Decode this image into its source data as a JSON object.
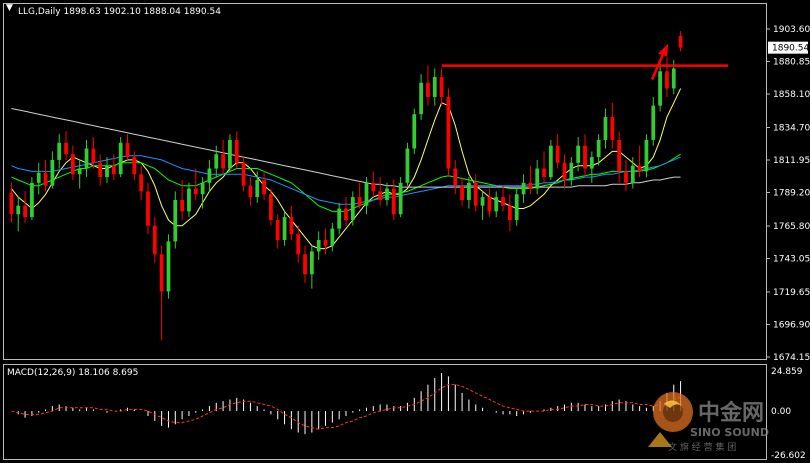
{
  "header": {
    "symbol_line": "LLG,Daily  1898.63 1902.10 1888.04 1890.54",
    "macd_line": "MACD(12,26,9) 18.106 8.695"
  },
  "price_axis": {
    "ticks": [
      "1903.60",
      "1880.85",
      "1858.10",
      "1834.70",
      "1811.95",
      "1789.20",
      "1765.80",
      "1743.05",
      "1719.65",
      "1696.90",
      "1674.15"
    ],
    "current_price": "1890.54"
  },
  "macd_axis": {
    "ticks": [
      "24.859",
      "0.00",
      "-26.602"
    ]
  },
  "watermark": {
    "chinese": "中金网",
    "english": "SINO SOUND",
    "sub": "文 旗 经 营 集 团"
  },
  "colors": {
    "background": "#000000",
    "bull_candle": "#32cd32",
    "bear_candle": "#ff0000",
    "ma_fast": "#ffff66",
    "ma_mid": "#00ff00",
    "ma_slow": "#1e90ff",
    "ma_long": "#d0d0d0",
    "annotation": "#ff0000",
    "macd_hist": "#ffffff",
    "macd_signal": "#ff3030"
  },
  "chart_data": {
    "type": "candlestick",
    "ylim": [
      1674.15,
      1903.6
    ],
    "candles": [
      {
        "o": 1789,
        "h": 1796,
        "l": 1768,
        "c": 1774
      },
      {
        "o": 1774,
        "h": 1786,
        "l": 1762,
        "c": 1780
      },
      {
        "o": 1780,
        "h": 1790,
        "l": 1768,
        "c": 1772
      },
      {
        "o": 1772,
        "h": 1800,
        "l": 1770,
        "c": 1796
      },
      {
        "o": 1796,
        "h": 1810,
        "l": 1788,
        "c": 1803
      },
      {
        "o": 1803,
        "h": 1812,
        "l": 1790,
        "c": 1794
      },
      {
        "o": 1794,
        "h": 1818,
        "l": 1792,
        "c": 1812
      },
      {
        "o": 1812,
        "h": 1830,
        "l": 1806,
        "c": 1824
      },
      {
        "o": 1824,
        "h": 1832,
        "l": 1812,
        "c": 1816
      },
      {
        "o": 1816,
        "h": 1822,
        "l": 1798,
        "c": 1802
      },
      {
        "o": 1802,
        "h": 1812,
        "l": 1792,
        "c": 1806
      },
      {
        "o": 1806,
        "h": 1826,
        "l": 1800,
        "c": 1820
      },
      {
        "o": 1820,
        "h": 1828,
        "l": 1806,
        "c": 1810
      },
      {
        "o": 1810,
        "h": 1816,
        "l": 1794,
        "c": 1800
      },
      {
        "o": 1800,
        "h": 1814,
        "l": 1796,
        "c": 1808
      },
      {
        "o": 1808,
        "h": 1816,
        "l": 1798,
        "c": 1802
      },
      {
        "o": 1802,
        "h": 1828,
        "l": 1800,
        "c": 1824
      },
      {
        "o": 1824,
        "h": 1830,
        "l": 1812,
        "c": 1814
      },
      {
        "o": 1814,
        "h": 1818,
        "l": 1798,
        "c": 1802
      },
      {
        "o": 1802,
        "h": 1808,
        "l": 1784,
        "c": 1790
      },
      {
        "o": 1790,
        "h": 1796,
        "l": 1760,
        "c": 1766
      },
      {
        "o": 1766,
        "h": 1772,
        "l": 1740,
        "c": 1746
      },
      {
        "o": 1746,
        "h": 1752,
        "l": 1686,
        "c": 1720
      },
      {
        "o": 1720,
        "h": 1760,
        "l": 1715,
        "c": 1755
      },
      {
        "o": 1755,
        "h": 1790,
        "l": 1750,
        "c": 1784
      },
      {
        "o": 1784,
        "h": 1798,
        "l": 1770,
        "c": 1776
      },
      {
        "o": 1776,
        "h": 1796,
        "l": 1772,
        "c": 1792
      },
      {
        "o": 1792,
        "h": 1806,
        "l": 1784,
        "c": 1788
      },
      {
        "o": 1788,
        "h": 1800,
        "l": 1778,
        "c": 1796
      },
      {
        "o": 1796,
        "h": 1812,
        "l": 1790,
        "c": 1806
      },
      {
        "o": 1806,
        "h": 1822,
        "l": 1800,
        "c": 1816
      },
      {
        "o": 1816,
        "h": 1826,
        "l": 1802,
        "c": 1806
      },
      {
        "o": 1806,
        "h": 1830,
        "l": 1804,
        "c": 1826
      },
      {
        "o": 1826,
        "h": 1832,
        "l": 1806,
        "c": 1810
      },
      {
        "o": 1810,
        "h": 1814,
        "l": 1790,
        "c": 1794
      },
      {
        "o": 1794,
        "h": 1800,
        "l": 1780,
        "c": 1786
      },
      {
        "o": 1786,
        "h": 1804,
        "l": 1782,
        "c": 1798
      },
      {
        "o": 1798,
        "h": 1804,
        "l": 1784,
        "c": 1788
      },
      {
        "o": 1788,
        "h": 1792,
        "l": 1766,
        "c": 1770
      },
      {
        "o": 1770,
        "h": 1774,
        "l": 1750,
        "c": 1756
      },
      {
        "o": 1756,
        "h": 1776,
        "l": 1752,
        "c": 1772
      },
      {
        "o": 1772,
        "h": 1780,
        "l": 1756,
        "c": 1760
      },
      {
        "o": 1760,
        "h": 1766,
        "l": 1740,
        "c": 1746
      },
      {
        "o": 1746,
        "h": 1752,
        "l": 1726,
        "c": 1732
      },
      {
        "o": 1732,
        "h": 1752,
        "l": 1722,
        "c": 1748
      },
      {
        "o": 1748,
        "h": 1762,
        "l": 1742,
        "c": 1756
      },
      {
        "o": 1756,
        "h": 1764,
        "l": 1746,
        "c": 1752
      },
      {
        "o": 1752,
        "h": 1768,
        "l": 1748,
        "c": 1764
      },
      {
        "o": 1764,
        "h": 1782,
        "l": 1760,
        "c": 1778
      },
      {
        "o": 1778,
        "h": 1786,
        "l": 1766,
        "c": 1770
      },
      {
        "o": 1770,
        "h": 1790,
        "l": 1766,
        "c": 1786
      },
      {
        "o": 1786,
        "h": 1796,
        "l": 1778,
        "c": 1780
      },
      {
        "o": 1780,
        "h": 1800,
        "l": 1774,
        "c": 1796
      },
      {
        "o": 1796,
        "h": 1804,
        "l": 1786,
        "c": 1790
      },
      {
        "o": 1790,
        "h": 1800,
        "l": 1780,
        "c": 1784
      },
      {
        "o": 1784,
        "h": 1796,
        "l": 1780,
        "c": 1792
      },
      {
        "o": 1792,
        "h": 1798,
        "l": 1770,
        "c": 1774
      },
      {
        "o": 1774,
        "h": 1800,
        "l": 1772,
        "c": 1796
      },
      {
        "o": 1796,
        "h": 1824,
        "l": 1794,
        "c": 1820
      },
      {
        "o": 1820,
        "h": 1848,
        "l": 1816,
        "c": 1844
      },
      {
        "o": 1844,
        "h": 1872,
        "l": 1840,
        "c": 1866
      },
      {
        "o": 1866,
        "h": 1878,
        "l": 1850,
        "c": 1856
      },
      {
        "o": 1856,
        "h": 1876,
        "l": 1850,
        "c": 1870
      },
      {
        "o": 1870,
        "h": 1876,
        "l": 1850,
        "c": 1856
      },
      {
        "o": 1856,
        "h": 1862,
        "l": 1800,
        "c": 1806
      },
      {
        "o": 1806,
        "h": 1812,
        "l": 1788,
        "c": 1794
      },
      {
        "o": 1794,
        "h": 1800,
        "l": 1780,
        "c": 1784
      },
      {
        "o": 1784,
        "h": 1800,
        "l": 1778,
        "c": 1796
      },
      {
        "o": 1796,
        "h": 1802,
        "l": 1776,
        "c": 1780
      },
      {
        "o": 1780,
        "h": 1790,
        "l": 1770,
        "c": 1786
      },
      {
        "o": 1786,
        "h": 1792,
        "l": 1772,
        "c": 1776
      },
      {
        "o": 1776,
        "h": 1790,
        "l": 1772,
        "c": 1786
      },
      {
        "o": 1786,
        "h": 1794,
        "l": 1776,
        "c": 1780
      },
      {
        "o": 1780,
        "h": 1788,
        "l": 1762,
        "c": 1770
      },
      {
        "o": 1770,
        "h": 1792,
        "l": 1766,
        "c": 1788
      },
      {
        "o": 1788,
        "h": 1802,
        "l": 1782,
        "c": 1796
      },
      {
        "o": 1796,
        "h": 1808,
        "l": 1788,
        "c": 1792
      },
      {
        "o": 1792,
        "h": 1812,
        "l": 1788,
        "c": 1806
      },
      {
        "o": 1806,
        "h": 1818,
        "l": 1796,
        "c": 1800
      },
      {
        "o": 1800,
        "h": 1826,
        "l": 1798,
        "c": 1822
      },
      {
        "o": 1822,
        "h": 1830,
        "l": 1806,
        "c": 1810
      },
      {
        "o": 1810,
        "h": 1816,
        "l": 1792,
        "c": 1798
      },
      {
        "o": 1798,
        "h": 1814,
        "l": 1794,
        "c": 1810
      },
      {
        "o": 1810,
        "h": 1828,
        "l": 1804,
        "c": 1822
      },
      {
        "o": 1822,
        "h": 1830,
        "l": 1800,
        "c": 1806
      },
      {
        "o": 1806,
        "h": 1818,
        "l": 1796,
        "c": 1814
      },
      {
        "o": 1814,
        "h": 1830,
        "l": 1808,
        "c": 1826
      },
      {
        "o": 1826,
        "h": 1848,
        "l": 1820,
        "c": 1842
      },
      {
        "o": 1842,
        "h": 1852,
        "l": 1820,
        "c": 1826
      },
      {
        "o": 1826,
        "h": 1832,
        "l": 1796,
        "c": 1804
      },
      {
        "o": 1804,
        "h": 1812,
        "l": 1790,
        "c": 1796
      },
      {
        "o": 1796,
        "h": 1814,
        "l": 1792,
        "c": 1808
      },
      {
        "o": 1808,
        "h": 1822,
        "l": 1800,
        "c": 1804
      },
      {
        "o": 1804,
        "h": 1830,
        "l": 1800,
        "c": 1826
      },
      {
        "o": 1826,
        "h": 1856,
        "l": 1822,
        "c": 1850
      },
      {
        "o": 1850,
        "h": 1880,
        "l": 1846,
        "c": 1874
      },
      {
        "o": 1874,
        "h": 1884,
        "l": 1856,
        "c": 1862
      },
      {
        "o": 1862,
        "h": 1882,
        "l": 1858,
        "c": 1876
      },
      {
        "o": 1898.63,
        "h": 1902.1,
        "l": 1888.04,
        "c": 1890.54
      }
    ],
    "moving_averages": [
      {
        "name": "",
        "color": "#ffff66",
        "values": [
          1792,
          1786,
          1782,
          1778,
          1782,
          1788,
          1796,
          1804,
          1810,
          1814,
          1812,
          1810,
          1808,
          1806,
          1806,
          1808,
          1810,
          1812,
          1812,
          1810,
          1804,
          1794,
          1780,
          1770,
          1766,
          1766,
          1770,
          1774,
          1782,
          1790,
          1796,
          1800,
          1806,
          1810,
          1810,
          1806,
          1800,
          1794,
          1790,
          1784,
          1776,
          1770,
          1764,
          1758,
          1752,
          1750,
          1750,
          1752,
          1758,
          1764,
          1770,
          1776,
          1782,
          1786,
          1788,
          1790,
          1788,
          1788,
          1792,
          1800,
          1812,
          1826,
          1840,
          1852,
          1850,
          1836,
          1818,
          1802,
          1794,
          1790,
          1786,
          1784,
          1782,
          1780,
          1778,
          1778,
          1780,
          1784,
          1788,
          1794,
          1798,
          1802,
          1806,
          1808,
          1808,
          1808,
          1810,
          1814,
          1818,
          1818,
          1814,
          1810,
          1806,
          1808,
          1814,
          1826,
          1842,
          1852,
          1862
        ]
      },
      {
        "name": "",
        "color": "#00ff00",
        "values": [
          1800,
          1798,
          1796,
          1794,
          1794,
          1796,
          1798,
          1800,
          1802,
          1804,
          1806,
          1806,
          1808,
          1808,
          1808,
          1808,
          1810,
          1810,
          1810,
          1810,
          1808,
          1806,
          1802,
          1798,
          1796,
          1794,
          1794,
          1794,
          1796,
          1798,
          1800,
          1802,
          1804,
          1806,
          1806,
          1806,
          1806,
          1804,
          1802,
          1800,
          1798,
          1796,
          1792,
          1788,
          1784,
          1780,
          1778,
          1776,
          1776,
          1776,
          1778,
          1780,
          1782,
          1784,
          1786,
          1788,
          1788,
          1789,
          1790,
          1792,
          1794,
          1796,
          1798,
          1800,
          1801,
          1800,
          1799,
          1798,
          1797,
          1796,
          1795,
          1794,
          1793,
          1792,
          1792,
          1792,
          1792,
          1793,
          1794,
          1795,
          1796,
          1798,
          1799,
          1800,
          1801,
          1802,
          1802,
          1803,
          1804,
          1804,
          1804,
          1804,
          1804,
          1805,
          1806,
          1808,
          1810,
          1813,
          1816
        ]
      },
      {
        "name": "",
        "color": "#1e90ff",
        "values": [
          1808,
          1806,
          1805,
          1804,
          1804,
          1804,
          1804,
          1805,
          1806,
          1807,
          1808,
          1809,
          1810,
          1811,
          1812,
          1813,
          1814,
          1815,
          1815,
          1815,
          1814,
          1813,
          1812,
          1810,
          1808,
          1806,
          1805,
          1804,
          1803,
          1802,
          1802,
          1802,
          1802,
          1802,
          1802,
          1801,
          1800,
          1799,
          1798,
          1796,
          1794,
          1792,
          1790,
          1788,
          1786,
          1784,
          1783,
          1782,
          1781,
          1781,
          1781,
          1782,
          1783,
          1784,
          1785,
          1786,
          1786,
          1787,
          1788,
          1789,
          1790,
          1791,
          1792,
          1793,
          1794,
          1794,
          1794,
          1794,
          1794,
          1794,
          1794,
          1794,
          1794,
          1794,
          1794,
          1794,
          1795,
          1795,
          1796,
          1796,
          1797,
          1798,
          1798,
          1799,
          1800,
          1800,
          1801,
          1802,
          1802,
          1803,
          1804,
          1804,
          1805,
          1806,
          1807,
          1808,
          1810,
          1812,
          1814
        ]
      },
      {
        "name": "",
        "color": "#d0d0d0",
        "values": [
          1848,
          1847,
          1846,
          1845,
          1844,
          1843,
          1842,
          1841,
          1840,
          1839,
          1838,
          1837,
          1836,
          1835,
          1834,
          1833,
          1832,
          1831,
          1830,
          1829,
          1828,
          1827,
          1826,
          1825,
          1824,
          1823,
          1822,
          1821,
          1820,
          1819,
          1818,
          1817,
          1816,
          1815,
          1814,
          1813,
          1812,
          1811,
          1810,
          1809,
          1808,
          1807,
          1806,
          1805,
          1804,
          1803,
          1802,
          1801,
          1800,
          1799,
          1798,
          1797,
          1796,
          1795,
          1795,
          1794,
          1794,
          1793,
          1793,
          1793,
          1793,
          1793,
          1793,
          1793,
          1793,
          1793,
          1793,
          1793,
          1793,
          1793,
          1793,
          1793,
          1793,
          1793,
          1793,
          1793,
          1793,
          1793,
          1793,
          1793,
          1793,
          1793,
          1793,
          1794,
          1794,
          1794,
          1794,
          1794,
          1795,
          1795,
          1795,
          1796,
          1796,
          1797,
          1798,
          1798,
          1799,
          1800,
          1800
        ]
      }
    ],
    "annotations": {
      "resistance_level": 1878,
      "resistance_from_index": 63,
      "arrow_index": 95
    },
    "macd": {
      "ylim": [
        -26.602,
        24.859
      ],
      "histogram": [
        0,
        -2,
        -4,
        -3,
        -1,
        1,
        3,
        4,
        3,
        2,
        1,
        2,
        1,
        0,
        -1,
        0,
        1,
        2,
        1,
        0,
        -3,
        -6,
        -9,
        -10,
        -8,
        -5,
        -3,
        -1,
        1,
        3,
        5,
        6,
        7,
        8,
        7,
        5,
        3,
        1,
        -2,
        -5,
        -8,
        -11,
        -13,
        -14,
        -13,
        -11,
        -9,
        -7,
        -5,
        -3,
        -1,
        1,
        2,
        3,
        4,
        4,
        3,
        3,
        5,
        8,
        12,
        16,
        20,
        23,
        21,
        16,
        11,
        7,
        4,
        2,
        0,
        -1,
        -2,
        -2,
        -3,
        -2,
        -1,
        0,
        1,
        2,
        3,
        4,
        5,
        5,
        4,
        3,
        3,
        4,
        6,
        7,
        6,
        4,
        3,
        2,
        3,
        6,
        11,
        16,
        18.106
      ],
      "signal": [
        0,
        -1,
        -2,
        -2,
        -2,
        -1,
        0,
        2,
        2,
        2,
        2,
        2,
        2,
        1,
        1,
        0,
        0,
        1,
        1,
        1,
        0,
        -2,
        -4,
        -6,
        -7,
        -7,
        -6,
        -5,
        -3,
        -1,
        1,
        2,
        4,
        5,
        6,
        6,
        5,
        4,
        3,
        1,
        -2,
        -4,
        -7,
        -9,
        -10,
        -11,
        -10,
        -10,
        -9,
        -7,
        -6,
        -4,
        -3,
        -1,
        0,
        1,
        2,
        2,
        3,
        4,
        6,
        8,
        11,
        14,
        16,
        16,
        15,
        13,
        11,
        9,
        7,
        5,
        3,
        2,
        1,
        0,
        0,
        0,
        0,
        1,
        1,
        2,
        3,
        3,
        4,
        4,
        3,
        3,
        4,
        5,
        5,
        5,
        4,
        4,
        3,
        4,
        5,
        7,
        8.695
      ]
    }
  }
}
